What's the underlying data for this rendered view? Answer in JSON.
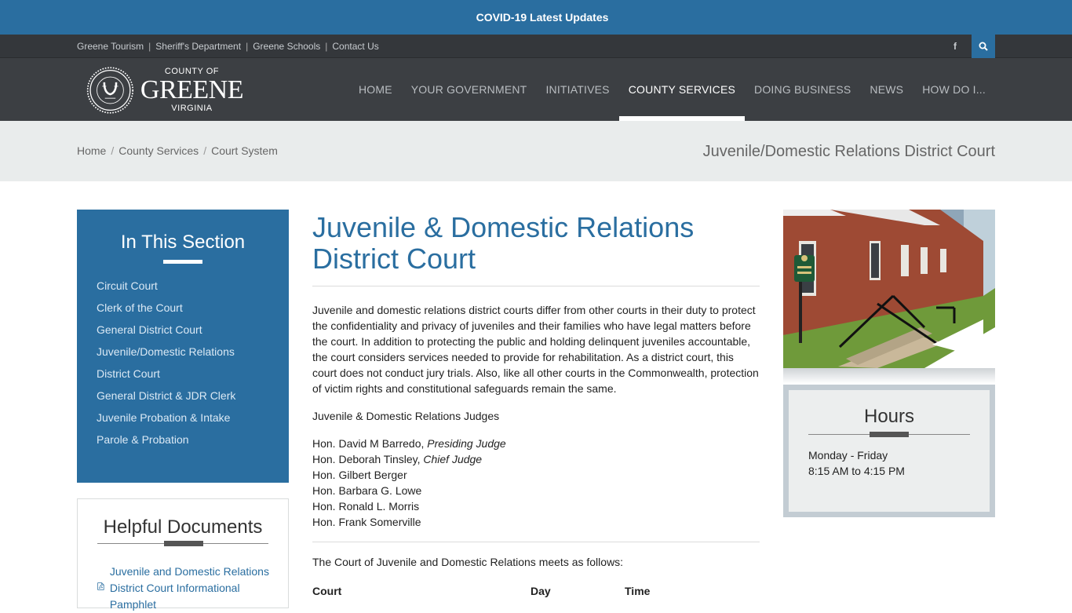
{
  "alert": {
    "text": "COVID-19 Latest Updates"
  },
  "utility": {
    "links": [
      "Greene Tourism",
      "Sheriff's Department",
      "Greene Schools",
      "Contact Us"
    ],
    "facebook_glyph": "f"
  },
  "logo": {
    "line1": "COUNTY OF",
    "line2": "GREENE",
    "line3": "VIRGINIA"
  },
  "nav": {
    "items": [
      "HOME",
      "YOUR GOVERNMENT",
      "INITIATIVES",
      "COUNTY SERVICES",
      "DOING BUSINESS",
      "NEWS",
      "HOW DO I..."
    ],
    "active": "COUNTY SERVICES"
  },
  "breadcrumb": {
    "items": [
      "Home",
      "County Services",
      "Court System"
    ],
    "page_title": "Juvenile/Domestic Relations District Court"
  },
  "section_nav": {
    "title": "In This Section",
    "items": [
      "Circuit Court",
      "Clerk of the Court",
      "General District Court",
      "Juvenile/Domestic Relations",
      "District Court",
      "General District & JDR Clerk",
      "Juvenile Probation & Intake",
      "Parole & Probation"
    ]
  },
  "documents": {
    "title": "Helpful Documents",
    "link": "Juvenile and Domestic Relations District Court Informational Pamphlet"
  },
  "main": {
    "title": " Juvenile & Domestic Relations District Court",
    "intro": "Juvenile and domestic relations district courts differ from other courts in their duty to protect the confidentiality and privacy of juveniles and their families who have legal matters before the court. In addition to protecting the public and holding delinquent juveniles accountable, the court considers services needed to provide for rehabilitation. As a district court, this court does not conduct jury trials. Also, like all other courts in the Commonwealth, protection of victim rights and constitutional safeguards remain the same.",
    "judges_heading": "Juvenile & Domestic Relations Judges",
    "judges": [
      {
        "name": "Hon. David M Barredo, ",
        "role": "Presiding Judge"
      },
      {
        "name": "Hon. Deborah Tinsley, ",
        "role": "Chief Judge"
      },
      {
        "name": "Hon. Gilbert Berger",
        "role": ""
      },
      {
        "name": "Hon. Barbara G. Lowe",
        "role": ""
      },
      {
        "name": "Hon. Ronald L. Morris",
        "role": ""
      },
      {
        "name": "Hon. Frank Somerville",
        "role": ""
      }
    ],
    "meets_text": "The Court of Juvenile and Domestic Relations meets as follows:",
    "table_headers": [
      "Court",
      "Day",
      "Time"
    ]
  },
  "hours": {
    "title": "Hours",
    "days": "Monday - Friday",
    "times": "8:15 AM to 4:15 PM"
  },
  "colors": {
    "primary_blue": "#2a6ea0",
    "dark_nav": "#3c3f43",
    "utility_bar": "#34373b",
    "crumb_bg": "#e9ecec"
  }
}
